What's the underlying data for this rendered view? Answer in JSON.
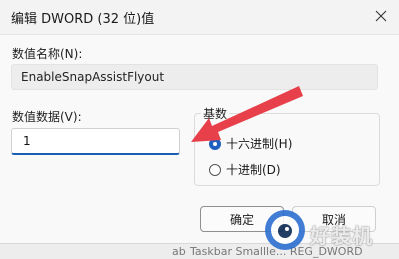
{
  "window": {
    "title": "编辑 DWORD (32 位)值"
  },
  "fields": {
    "value_name_label": "数值名称(N):",
    "value_name": "EnableSnapAssistFlyout",
    "value_data_label": "数值数据(V):",
    "value_data": "1"
  },
  "base": {
    "label": "基数",
    "options": [
      {
        "label": "十六进制(H)",
        "selected": true
      },
      {
        "label": "十进制(D)",
        "selected": false
      }
    ]
  },
  "buttons": {
    "ok": "确定",
    "cancel": "取消"
  },
  "background_strip": {
    "left_text": "ab",
    "right_text": "Taskbar Smallle... REG_DWORD"
  },
  "watermark": {
    "text": "好装机"
  },
  "colors": {
    "accent": "#1f5fbf",
    "arrow": "#e8404a"
  }
}
